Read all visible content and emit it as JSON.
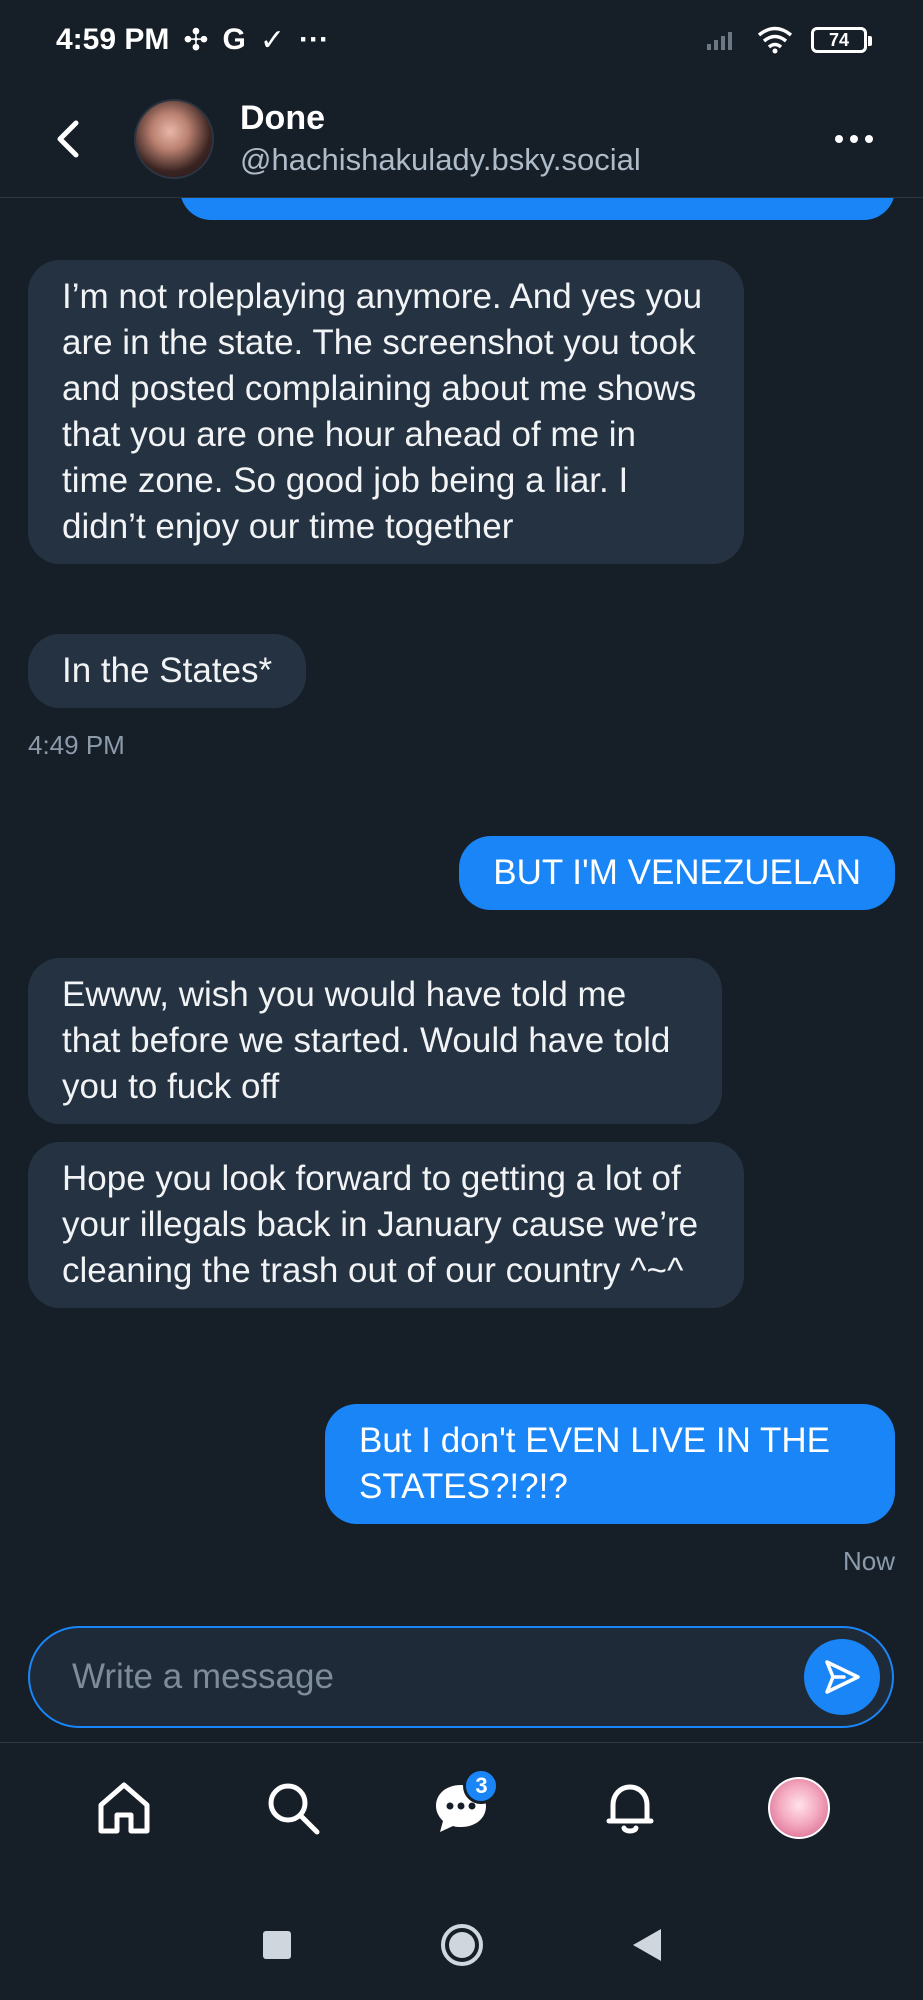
{
  "status_bar": {
    "time": "4:59 PM",
    "icons": [
      "pinwheel-icon",
      "google-icon",
      "checkmark-icon",
      "more-icon"
    ],
    "battery": "74"
  },
  "header": {
    "name": "Done",
    "handle": "@hachishakulady.bsky.social"
  },
  "messages": [
    {
      "direction": "incoming",
      "text": "I’m not roleplaying anymore. And yes you are in the state. The screenshot you took and posted complaining about me shows that you are one hour ahead of me in time zone. So good job being a liar. I didn’t enjoy our time together"
    },
    {
      "direction": "incoming",
      "text": "In the States*"
    },
    {
      "direction": "incoming",
      "timestamp": "4:49 PM"
    },
    {
      "direction": "outgoing",
      "text": "BUT I'M VENEZUELAN"
    },
    {
      "direction": "incoming",
      "text": "Ewww, wish you would have told me that before we started. Would have told you to fuck off"
    },
    {
      "direction": "incoming",
      "text": "Hope you look forward to getting a lot of your illegals back in January cause we’re cleaning the trash out of our country ^~^"
    },
    {
      "direction": "outgoing",
      "text": "But I don't EVEN LIVE IN THE STATES?!?!?"
    },
    {
      "direction": "outgoing",
      "timestamp": "Now"
    }
  ],
  "composer": {
    "placeholder": "Write a message"
  },
  "bottom_nav": {
    "items": [
      "home-icon",
      "search-icon",
      "chat-icon",
      "bell-icon",
      "profile-avatar"
    ],
    "chat_badge": "3"
  },
  "colors": {
    "background": "#161e27",
    "incoming_bubble": "#243242",
    "outgoing_bubble": "#1a85f6"
  }
}
